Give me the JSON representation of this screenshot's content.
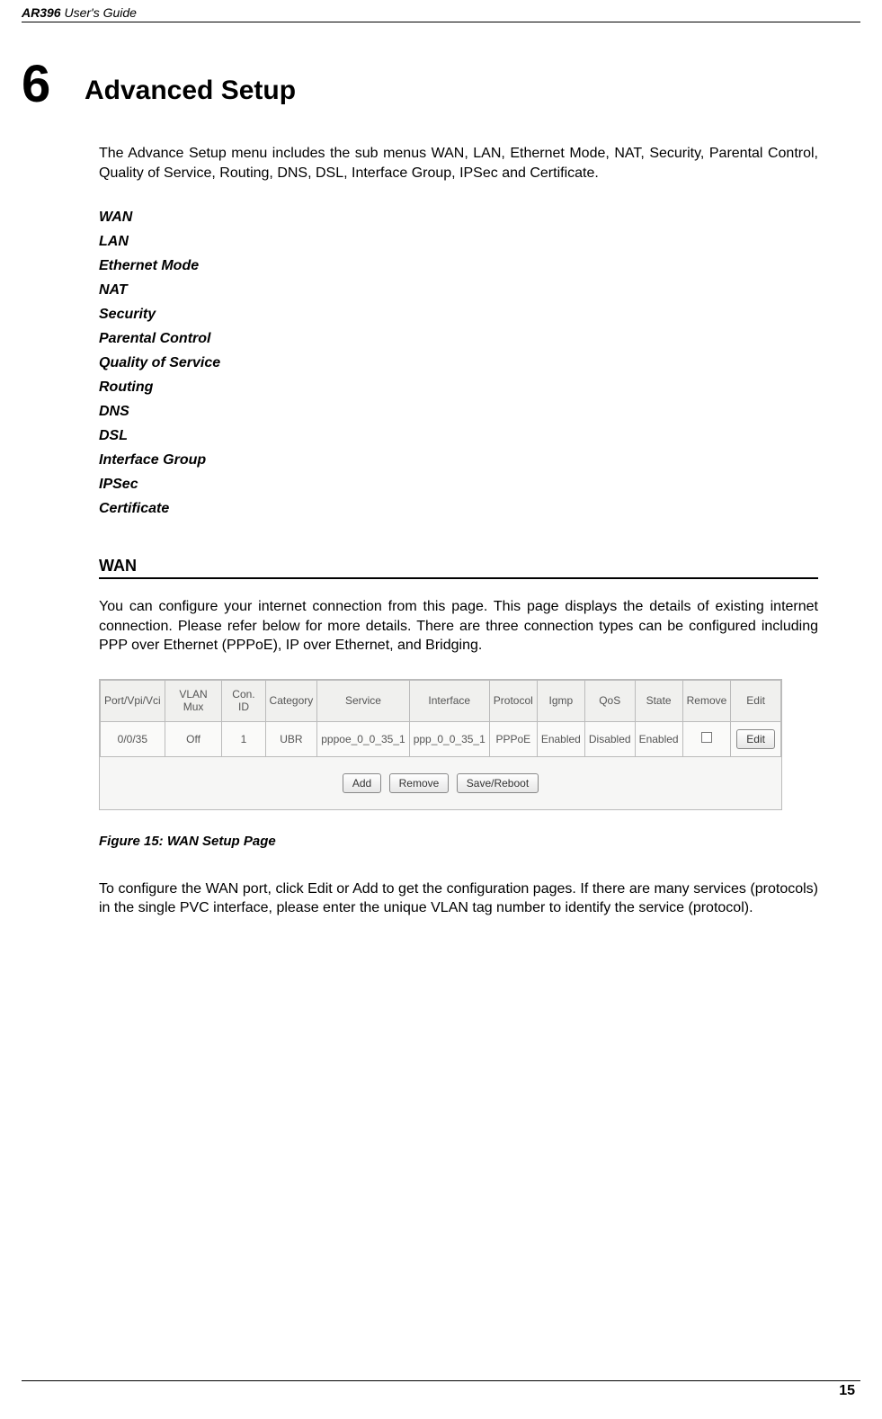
{
  "header": {
    "model": "AR396",
    "suffix": "User's Guide"
  },
  "chapter": {
    "number": "6",
    "title": "Advanced Setup"
  },
  "intro": "The Advance Setup menu includes the sub menus WAN, LAN, Ethernet Mode, NAT, Security, Parental Control, Quality of Service, Routing, DNS, DSL, Interface Group, IPSec and Certificate.",
  "menu_items": [
    "WAN",
    "LAN",
    "Ethernet Mode",
    "NAT",
    "Security",
    "Parental Control",
    "Quality of Service",
    "Routing",
    "DNS",
    "DSL",
    "Interface Group",
    "IPSec",
    "Certificate"
  ],
  "wan_section": {
    "heading": "WAN",
    "paragraph1": "You can configure your internet connection from this page. This page displays the details of existing internet connection. Please refer below for more details. There are three connection types can be configured including PPP over Ethernet (PPPoE), IP over Ethernet, and Bridging.",
    "figure_caption": "Figure 15: WAN Setup Page",
    "paragraph2": "To configure the WAN port, click Edit or Add to get the configuration pages. If there are many services (protocols) in the single PVC interface, please enter the unique VLAN tag number to identify the service (protocol)."
  },
  "wan_table": {
    "headers": [
      "Port/Vpi/Vci",
      "VLAN Mux",
      "Con. ID",
      "Category",
      "Service",
      "Interface",
      "Protocol",
      "Igmp",
      "QoS",
      "State",
      "Remove",
      "Edit"
    ],
    "row": {
      "port": "0/0/35",
      "vlan": "Off",
      "conid": "1",
      "category": "UBR",
      "service": "pppoe_0_0_35_1",
      "interface": "ppp_0_0_35_1",
      "protocol": "PPPoE",
      "igmp": "Enabled",
      "qos": "Disabled",
      "state": "Enabled",
      "edit_btn": "Edit"
    },
    "buttons": {
      "add": "Add",
      "remove": "Remove",
      "save": "Save/Reboot"
    }
  },
  "page_number": "15"
}
